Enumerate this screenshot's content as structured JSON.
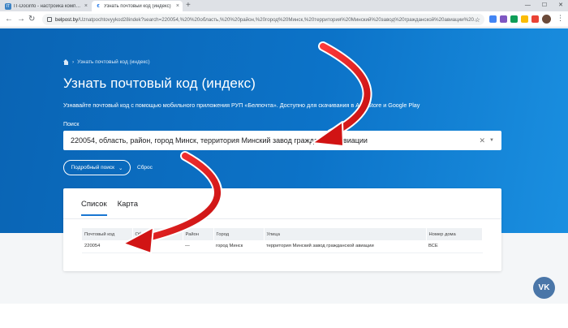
{
  "browser": {
    "tabs": [
      {
        "title": "IT-Docinfo - настройка компь...",
        "active": false
      },
      {
        "title": "Узнать почтовый код (индекс)",
        "active": true
      }
    ],
    "new_tab": "+",
    "window_controls": [
      "—",
      "☐",
      "✕"
    ],
    "url_host": "belpost.by",
    "url_path": "/Uznatpochtovyykod28indek?search=220054,%20%20область,%20%20район,%20город%20Минск,%20территория%20Минский%20завод%20гражданской%20авиации%20..."
  },
  "page": {
    "breadcrumb": "Узнать почтовый код (индекс)",
    "title": "Узнать почтовый код (индекс)",
    "subtitle": "Узнавайте почтовый код с помощью мобильного приложения РУП «Белпочта». Доступно для скачивания в App Store и Google Play",
    "search_label": "Поиск",
    "search_value": "220054, область, район, город Минск, территория Минский завод гражданской авиации",
    "advanced_search": "Подробный поиск",
    "reset": "Сброс",
    "tabs": [
      "Список",
      "Карта"
    ],
    "table": {
      "headers": [
        "Почтовый код",
        "Область",
        "Район",
        "Город",
        "Улица",
        "Номер дома"
      ],
      "rows": [
        [
          "220054",
          "",
          "—",
          "город Минск",
          "территория Минский завод гражданской авиации",
          "ВСЕ"
        ]
      ]
    },
    "vk_label": "VK"
  },
  "colors": {
    "hero": "#0c73c8",
    "annotation_arrow": "#e01b1b"
  }
}
